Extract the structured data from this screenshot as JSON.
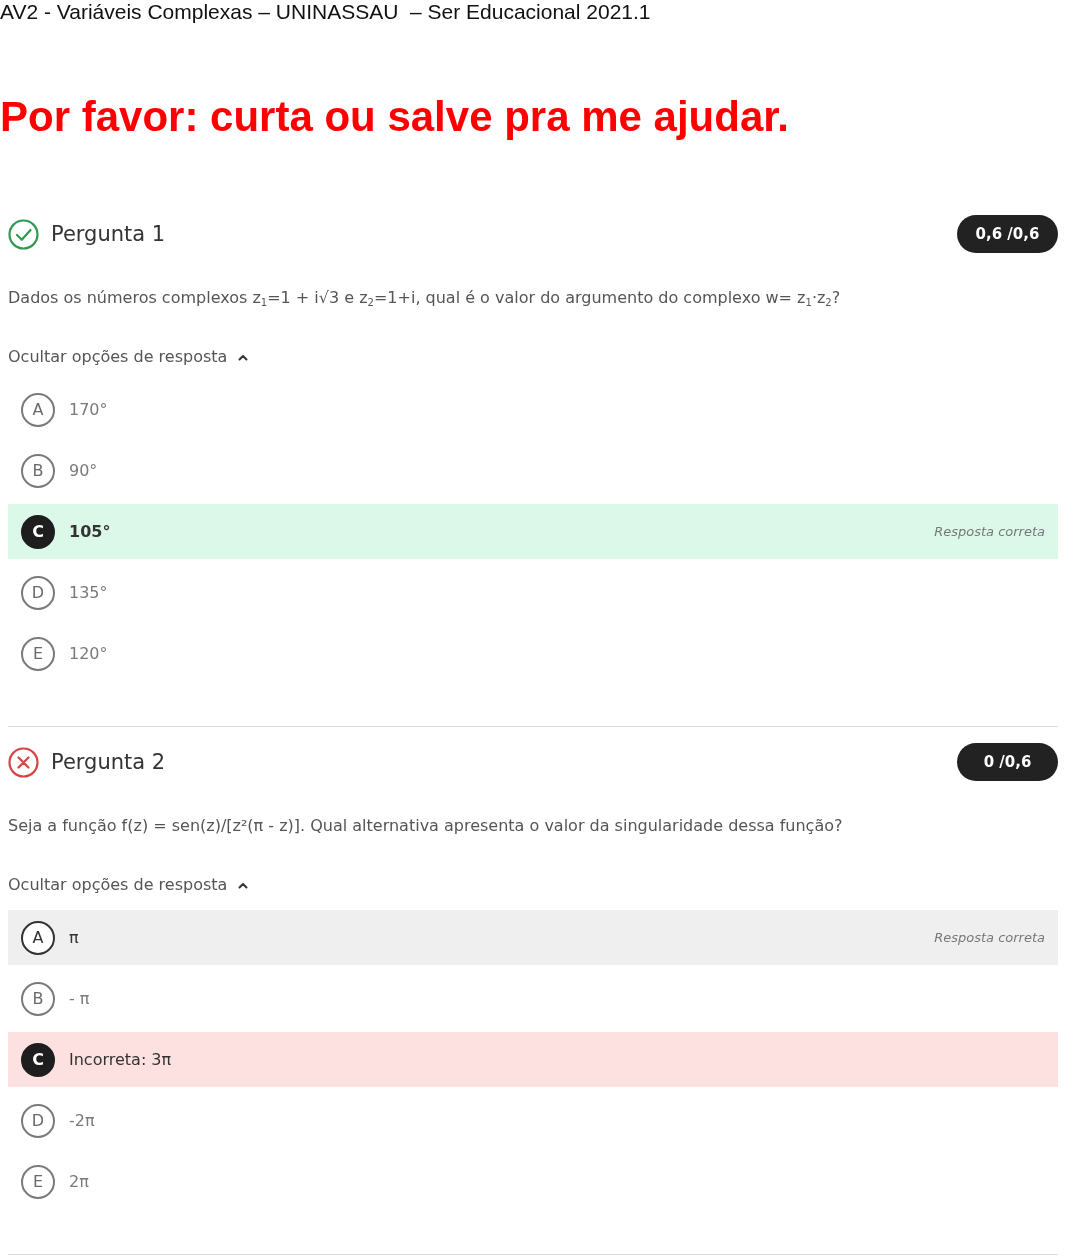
{
  "document": {
    "title": "AV2 - Variáveis Complexas – UNINASSAU  – Ser Educacional 2021.1",
    "banner": "Por favor: curta ou salve pra me ajudar."
  },
  "questions": [
    {
      "correct": true,
      "title": "Pergunta 1",
      "score": "0,6 /0,6",
      "prompt": "Dados os números complexos z$_{1}$=1 + i√3 e z$_{2}$=1+i, qual é o valor do argumento do complexo w= z$_{1}$·z$_{2}$?",
      "toggle": {
        "label": "Ocultar opções de resposta",
        "expanded": true
      },
      "options": [
        {
          "letter": "A",
          "text": "170°",
          "selected": false,
          "correct": false
        },
        {
          "letter": "B",
          "text": "90°",
          "selected": false,
          "correct": false
        },
        {
          "letter": "C",
          "text": "105°",
          "selected": true,
          "correct": true,
          "note": "Resposta correta"
        },
        {
          "letter": "D",
          "text": "135°",
          "selected": false,
          "correct": false
        },
        {
          "letter": "E",
          "text": "120°",
          "selected": false,
          "correct": false
        }
      ]
    },
    {
      "correct": false,
      "title": "Pergunta 2",
      "score": "0 /0,6",
      "prompt": "Seja a função f(z) = sen(z)/[z²(π - z)]. Qual alternativa apresenta o valor da singularidade dessa função?",
      "toggle": {
        "label": "Ocultar opções de resposta",
        "expanded": true
      },
      "options": [
        {
          "letter": "A",
          "text": "π",
          "selected": false,
          "correct": true,
          "note": "Resposta correta"
        },
        {
          "letter": "B",
          "text": "- π",
          "selected": false,
          "correct": false
        },
        {
          "letter": "C",
          "text": "Incorreta: 3π",
          "selected": true,
          "correct": false
        },
        {
          "letter": "D",
          "text": "-2π",
          "selected": false,
          "correct": false
        },
        {
          "letter": "E",
          "text": "2π",
          "selected": false,
          "correct": false
        }
      ]
    }
  ]
}
